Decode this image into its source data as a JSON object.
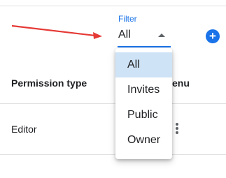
{
  "filter": {
    "label": "Filter",
    "value": "All",
    "options": [
      "All",
      "Invites",
      "Public",
      "Owner"
    ]
  },
  "add_button": {
    "icon": "plus-icon",
    "color": "#1a73e8"
  },
  "table": {
    "headers": [
      "Permission type",
      "enu"
    ],
    "rows": [
      {
        "permission": "Editor"
      }
    ]
  },
  "annotation": {
    "icon": "red-arrow",
    "color": "#e53935"
  },
  "colors": {
    "accent": "#1a73e8",
    "selected_bg": "#cfe3f6"
  }
}
